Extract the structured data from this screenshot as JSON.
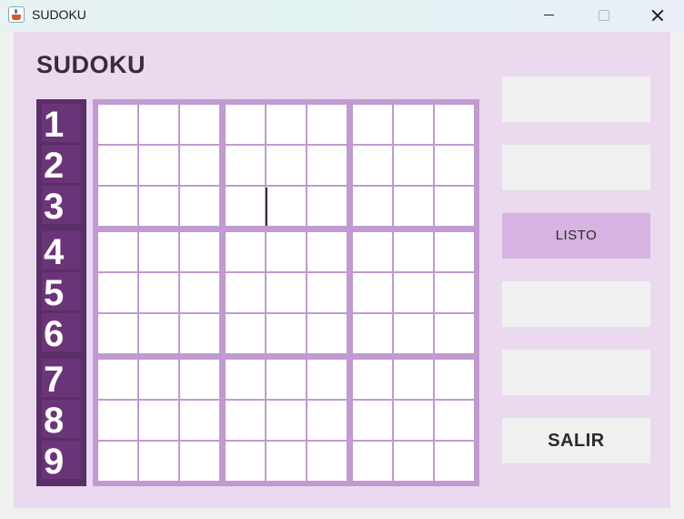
{
  "window": {
    "title": "SUDOKU",
    "icon": "java-cup-icon"
  },
  "heading": "SUDOKU",
  "row_numbers": [
    "1",
    "2",
    "3",
    "4",
    "5",
    "6",
    "7",
    "8",
    "9"
  ],
  "grid": {
    "size": 9,
    "values": [
      [
        "",
        "",
        "",
        "",
        "",
        "",
        "",
        "",
        ""
      ],
      [
        "",
        "",
        "",
        "",
        "",
        "",
        "",
        "",
        ""
      ],
      [
        "",
        "",
        "",
        "",
        "",
        "",
        "",
        "",
        ""
      ],
      [
        "",
        "",
        "",
        "",
        "",
        "",
        "",
        "",
        ""
      ],
      [
        "",
        "",
        "",
        "",
        "",
        "",
        "",
        "",
        ""
      ],
      [
        "",
        "",
        "",
        "",
        "",
        "",
        "",
        "",
        ""
      ],
      [
        "",
        "",
        "",
        "",
        "",
        "",
        "",
        "",
        ""
      ],
      [
        "",
        "",
        "",
        "",
        "",
        "",
        "",
        "",
        ""
      ],
      [
        "",
        "",
        "",
        "",
        "",
        "",
        "",
        "",
        ""
      ]
    ],
    "focused_cell": {
      "row": 3,
      "col": 4
    }
  },
  "side_buttons": [
    {
      "label": ""
    },
    {
      "label": ""
    },
    {
      "label": "LISTO"
    },
    {
      "label": ""
    },
    {
      "label": ""
    },
    {
      "label": "SALIR"
    }
  ],
  "colors": {
    "panel": "#ead9ef",
    "grid_border": "#c09ad0",
    "row_number_bg": "#5a2e66",
    "listo_button": "#d6b3e0"
  }
}
